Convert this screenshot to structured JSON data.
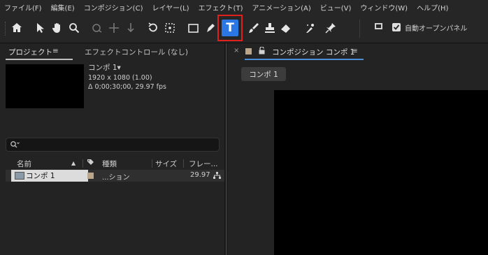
{
  "menu": [
    "ファイル(F)",
    "編集(E)",
    "コンポジション(C)",
    "レイヤー(L)",
    "エフェクト(T)",
    "アニメーション(A)",
    "ビュー(V)",
    "ウィンドウ(W)",
    "ヘルプ(H)"
  ],
  "toolbar": {
    "tools": [
      "home-icon",
      "selection-arrow-icon",
      "hand-icon",
      "zoom-icon",
      "orbit-camera-icon",
      "pan-camera-icon",
      "dolly-camera-icon",
      "rotate-icon",
      "pan-behind-icon",
      "rectangle-icon",
      "pen-icon",
      "type-tool-icon",
      "brush-icon",
      "clone-stamp-icon",
      "eraser-icon",
      "roto-brush-icon",
      "puppet-pin-icon"
    ],
    "type_tool_glyph": "T",
    "auto_open_panels_label": "自動オープンパネル",
    "auto_open_panels_checked": true
  },
  "project_panel": {
    "tab_project": "プロジェクト",
    "tab_effect_controls": "エフェクトコントロール (なし)",
    "comp_name": "コンポ 1",
    "comp_size": "1920 x 1080 (1.00)",
    "comp_duration": "Δ 0;00;30;00, 29.97 fps",
    "columns": [
      "名前",
      "種類",
      "サイズ",
      "フレー..."
    ],
    "items": [
      {
        "name": "コンポ 1",
        "type": "...ション",
        "fps": "29.97"
      }
    ]
  },
  "comp_panel": {
    "tab_label": "コンポジション コンポ 1",
    "comp_button": "コンポ 1"
  },
  "colors": {
    "highlight_border": "#e0201c",
    "type_tool_bg": "#2b78e4",
    "label_color": "#bca68a"
  }
}
